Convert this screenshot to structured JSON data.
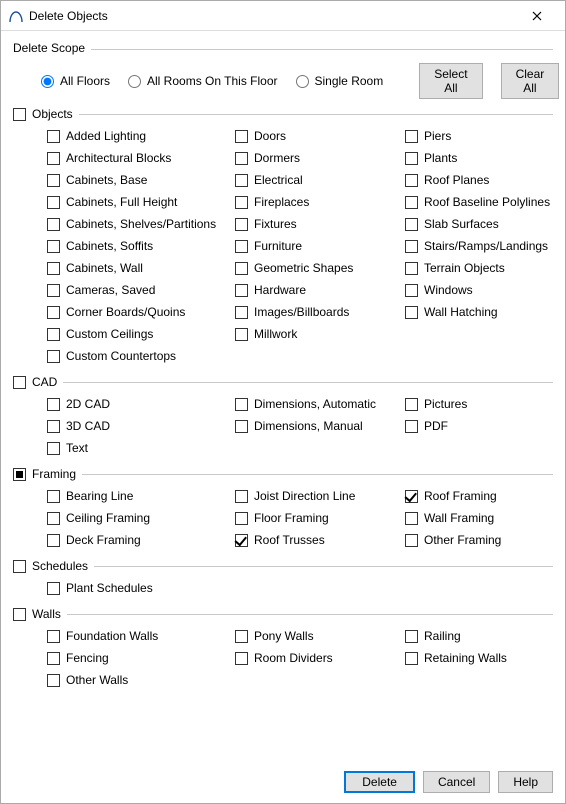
{
  "window": {
    "title": "Delete Objects"
  },
  "scope": {
    "legend": "Delete Scope",
    "options": [
      {
        "label": "All Floors",
        "selected": true
      },
      {
        "label": "All Rooms On This Floor",
        "selected": false
      },
      {
        "label": "Single Room",
        "selected": false
      }
    ],
    "select_all": "Select All",
    "clear_all": "Clear All"
  },
  "groups": [
    {
      "name": "Objects",
      "state": "unchecked",
      "items": [
        [
          "Added Lighting",
          false
        ],
        [
          "Doors",
          false
        ],
        [
          "Piers",
          false
        ],
        [
          "Architectural Blocks",
          false
        ],
        [
          "Dormers",
          false
        ],
        [
          "Plants",
          false
        ],
        [
          "Cabinets, Base",
          false
        ],
        [
          "Electrical",
          false
        ],
        [
          "Roof Planes",
          false
        ],
        [
          "Cabinets, Full Height",
          false
        ],
        [
          "Fireplaces",
          false
        ],
        [
          "Roof Baseline Polylines",
          false
        ],
        [
          "Cabinets, Shelves/Partitions",
          false
        ],
        [
          "Fixtures",
          false
        ],
        [
          "Slab Surfaces",
          false
        ],
        [
          "Cabinets, Soffits",
          false
        ],
        [
          "Furniture",
          false
        ],
        [
          "Stairs/Ramps/Landings",
          false
        ],
        [
          "Cabinets, Wall",
          false
        ],
        [
          "Geometric Shapes",
          false
        ],
        [
          "Terrain Objects",
          false
        ],
        [
          "Cameras, Saved",
          false
        ],
        [
          "Hardware",
          false
        ],
        [
          "Windows",
          false
        ],
        [
          "Corner Boards/Quoins",
          false
        ],
        [
          "Images/Billboards",
          false
        ],
        [
          "Wall Hatching",
          false
        ],
        [
          "Custom Ceilings",
          false
        ],
        [
          "Millwork",
          false
        ],
        [
          "",
          null
        ],
        [
          "Custom Countertops",
          false
        ],
        [
          "",
          null
        ],
        [
          "",
          null
        ]
      ]
    },
    {
      "name": "CAD",
      "state": "unchecked",
      "items": [
        [
          "2D CAD",
          false
        ],
        [
          "Dimensions, Automatic",
          false
        ],
        [
          "Pictures",
          false
        ],
        [
          "3D CAD",
          false
        ],
        [
          "Dimensions, Manual",
          false
        ],
        [
          "PDF",
          false
        ],
        [
          "Text",
          false
        ],
        [
          "",
          null
        ],
        [
          "",
          null
        ]
      ]
    },
    {
      "name": "Framing",
      "state": "indeterminate",
      "items": [
        [
          "Bearing Line",
          false
        ],
        [
          "Joist Direction Line",
          false
        ],
        [
          "Roof Framing",
          true
        ],
        [
          "Ceiling Framing",
          false
        ],
        [
          "Floor Framing",
          false
        ],
        [
          "Wall Framing",
          false
        ],
        [
          "Deck Framing",
          false
        ],
        [
          "Roof Trusses",
          true
        ],
        [
          "Other Framing",
          false
        ]
      ]
    },
    {
      "name": "Schedules",
      "state": "unchecked",
      "items": [
        [
          "Plant Schedules",
          false
        ],
        [
          "",
          null
        ],
        [
          "",
          null
        ]
      ]
    },
    {
      "name": "Walls",
      "state": "unchecked",
      "items": [
        [
          "Foundation Walls",
          false
        ],
        [
          "Pony Walls",
          false
        ],
        [
          "Railing",
          false
        ],
        [
          "Fencing",
          false
        ],
        [
          "Room Dividers",
          false
        ],
        [
          "Retaining Walls",
          false
        ],
        [
          "Other Walls",
          false
        ],
        [
          "",
          null
        ],
        [
          "",
          null
        ]
      ]
    }
  ],
  "buttons": {
    "delete": "Delete",
    "cancel": "Cancel",
    "help": "Help"
  }
}
